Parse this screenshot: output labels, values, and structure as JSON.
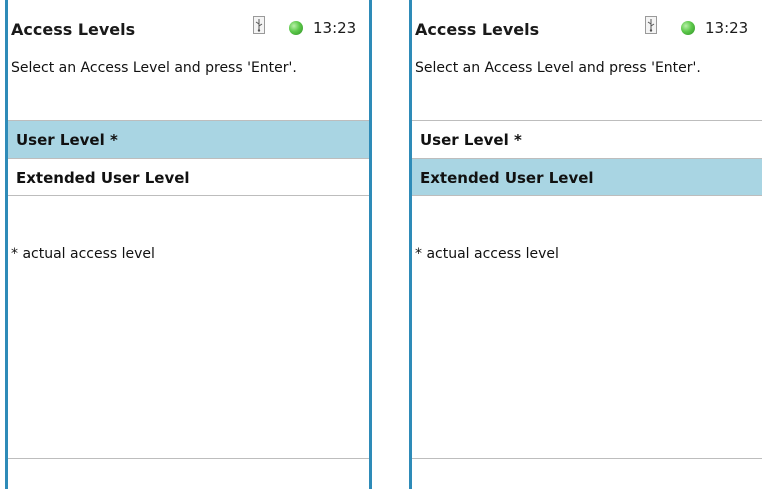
{
  "screens": [
    {
      "title": "Access Levels",
      "time": "13:23",
      "instruction": "Select an Access Level and press 'Enter'.",
      "items": [
        {
          "label": "User Level *",
          "selected": true
        },
        {
          "label": "Extended User Level",
          "selected": false
        }
      ],
      "footnote": "* actual access level"
    },
    {
      "title": "Access Levels",
      "time": "13:23",
      "instruction": "Select an Access Level and press 'Enter'.",
      "items": [
        {
          "label": "User Level *",
          "selected": false
        },
        {
          "label": "Extended User Level",
          "selected": true
        }
      ],
      "footnote": "* actual access level"
    }
  ],
  "icons": {
    "usb": "usb-icon",
    "status": "status-led-icon"
  },
  "colors": {
    "frame": "#2e8bb8",
    "selection": "#a9d5e3",
    "led": "#5cc84a"
  }
}
